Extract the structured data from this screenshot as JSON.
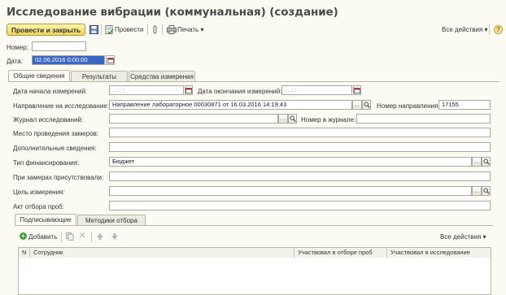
{
  "window": {
    "title": "Исследование вибрации (коммунальная) (создание)"
  },
  "toolbar": {
    "post_close": "Провести и закрыть",
    "post": "Провести",
    "print": "Печать",
    "all_actions": "Все действия",
    "help": "?"
  },
  "header": {
    "number_label": "Номер:",
    "number_value": "",
    "date_label": "Дата:",
    "date_value": "02.06.2016  0:00:00"
  },
  "tabs": [
    "Общие сведения",
    "Результаты",
    "Средства измерения"
  ],
  "form": {
    "start_date_label": "Дата начала измерений:",
    "start_date_value": ". .    : :",
    "end_date_label": "Дата окончания измерений:",
    "end_date_value": ". .    : :",
    "referral_label": "Направление на исследование:",
    "referral_value": "Направление лабораторное 00030871 от 16.03.2016 14:19:43",
    "referral_no_label": "Номер направления:",
    "referral_no_value": "17155",
    "journal_label": "Журнал исследований:",
    "journal_value": "",
    "journal_no_label": "Номер в журнале:",
    "journal_no_value": "",
    "place_label": "Место проведения замеров:",
    "extra_label": "Дополнительные сведения:",
    "funding_label": "Тип финансирования:",
    "funding_value": "Бюджет",
    "present_label": "При замерах присутствовали:",
    "purpose_label": "Цель измерения:",
    "sampling_act_label": "Акт отбора проб:"
  },
  "subtabs": [
    "Подписывающие",
    "Методики отбора"
  ],
  "subtoolbar": {
    "add": "Добавить",
    "all_actions": "Все действия"
  },
  "table": {
    "columns": [
      "N",
      "Сотрудник",
      "Участвовал в отборе проб",
      "Участвовал в исследование"
    ]
  }
}
